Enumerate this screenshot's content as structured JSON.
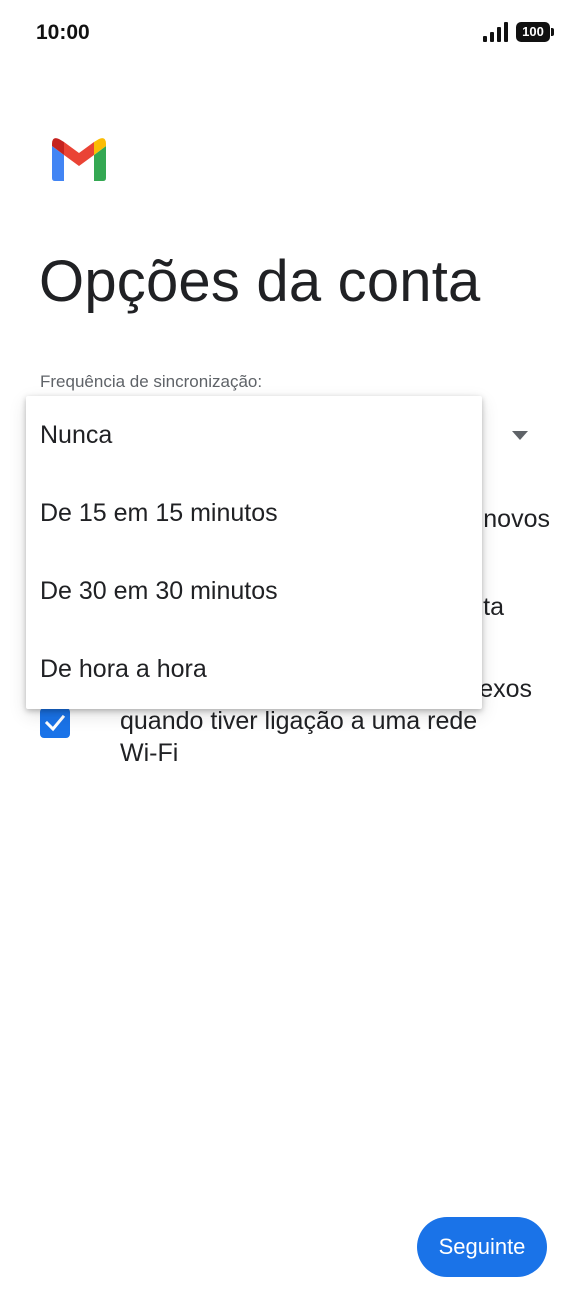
{
  "status_bar": {
    "time": "10:00",
    "battery": "100",
    "icons": [
      "cellular-signal-icon",
      "battery-icon"
    ]
  },
  "app": {
    "logo": "gmail-logo-icon",
    "title": "Opções da conta"
  },
  "sync_frequency": {
    "label": "Frequência de sincronização:",
    "options": [
      "Nunca",
      "De 15 em 15 minutos",
      "De 30 em 30 minutos",
      "De hora a hora"
    ]
  },
  "background_options": {
    "notify_fragment": "novos",
    "sync_fragment": "ta",
    "attachments_line1_fragment": "exos",
    "attachments_line2": "quando tiver ligação a uma rede",
    "attachments_line3": "Wi-Fi",
    "attachments_checked": true
  },
  "footer": {
    "next_label": "Seguinte"
  },
  "colors": {
    "accent": "#1a73e8",
    "text": "#202124",
    "secondary_text": "#5f6368"
  }
}
